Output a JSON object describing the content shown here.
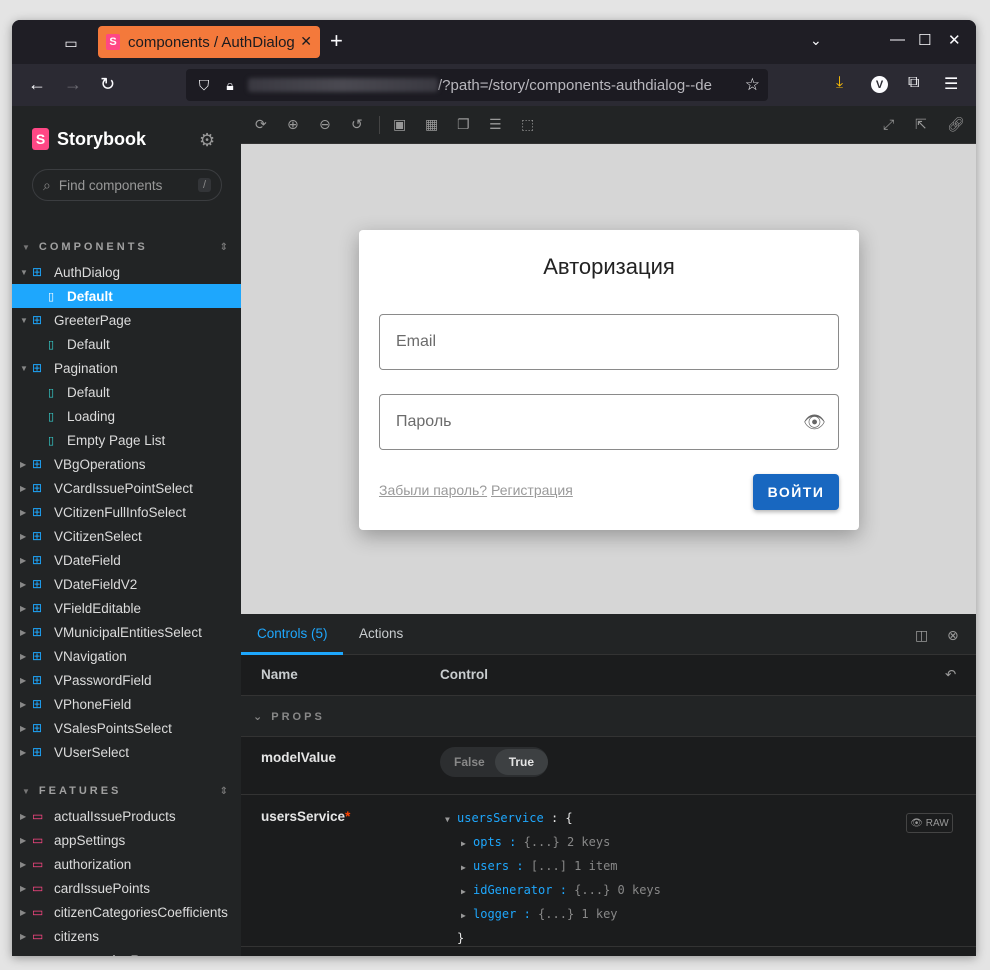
{
  "browser": {
    "tab_title": "components / AuthDialog – Default ⋅ Storybook",
    "url_suffix": "/?path=/story/components-authdialog--de"
  },
  "sidebar": {
    "brand": "Storybook",
    "search_placeholder": "Find components",
    "search_shortcut": "/",
    "components_heading": "COMPONENTS",
    "features_heading": "FEATURES",
    "components": [
      {
        "label": "AuthDialog",
        "kind": "component",
        "expanded": true
      },
      {
        "label": "Default",
        "kind": "story",
        "selected": true
      },
      {
        "label": "GreeterPage",
        "kind": "component",
        "expanded": true
      },
      {
        "label": "Default",
        "kind": "story"
      },
      {
        "label": "Pagination",
        "kind": "component",
        "expanded": true
      },
      {
        "label": "Default",
        "kind": "story"
      },
      {
        "label": "Loading",
        "kind": "story"
      },
      {
        "label": "Empty Page List",
        "kind": "story"
      },
      {
        "label": "VBgOperations",
        "kind": "component"
      },
      {
        "label": "VCardIssuePointSelect",
        "kind": "component"
      },
      {
        "label": "VCitizenFullInfoSelect",
        "kind": "component"
      },
      {
        "label": "VCitizenSelect",
        "kind": "component"
      },
      {
        "label": "VDateField",
        "kind": "component"
      },
      {
        "label": "VDateFieldV2",
        "kind": "component"
      },
      {
        "label": "VFieldEditable",
        "kind": "component"
      },
      {
        "label": "VMunicipalEntitiesSelect",
        "kind": "component"
      },
      {
        "label": "VNavigation",
        "kind": "component"
      },
      {
        "label": "VPasswordField",
        "kind": "component"
      },
      {
        "label": "VPhoneField",
        "kind": "component"
      },
      {
        "label": "VSalesPointsSelect",
        "kind": "component"
      },
      {
        "label": "VUserSelect",
        "kind": "component"
      }
    ],
    "features": [
      "actualIssueProducts",
      "appSettings",
      "authorization",
      "cardIssuePoints",
      "citizenCategoriesCoefficients",
      "citizens",
      "consumptionRates"
    ]
  },
  "dialog": {
    "title": "Авторизация",
    "email_label": "Email",
    "password_label": "Пароль",
    "forgot_link": "Забыли пароль?",
    "register_link": "Регистрация",
    "login_button": "ВОЙТИ"
  },
  "panel": {
    "tab_controls": "Controls (5)",
    "tab_actions": "Actions",
    "col_name": "Name",
    "col_control": "Control",
    "props_heading": "PROPS",
    "model_value": {
      "name": "modelValue",
      "false_label": "False",
      "true_label": "True",
      "selected": "True"
    },
    "users_service": {
      "name": "usersService",
      "required_mark": "*",
      "root_key": "usersService",
      "root_open": ": {",
      "root_close": "}",
      "raw_label": "RAW",
      "children": [
        {
          "key": "opts",
          "summary": "{...}",
          "count": "2 keys"
        },
        {
          "key": "users",
          "summary": "[...]",
          "count": "1 item"
        },
        {
          "key": "idGenerator",
          "summary": "{...}",
          "count": "0 keys"
        },
        {
          "key": "logger",
          "summary": "{...}",
          "count": "1 key"
        }
      ]
    }
  },
  "colors": {
    "accent": "#1ea7fd",
    "brand": "#ff4785",
    "tab_active": "#f4793b",
    "login_button": "#1867c0"
  }
}
